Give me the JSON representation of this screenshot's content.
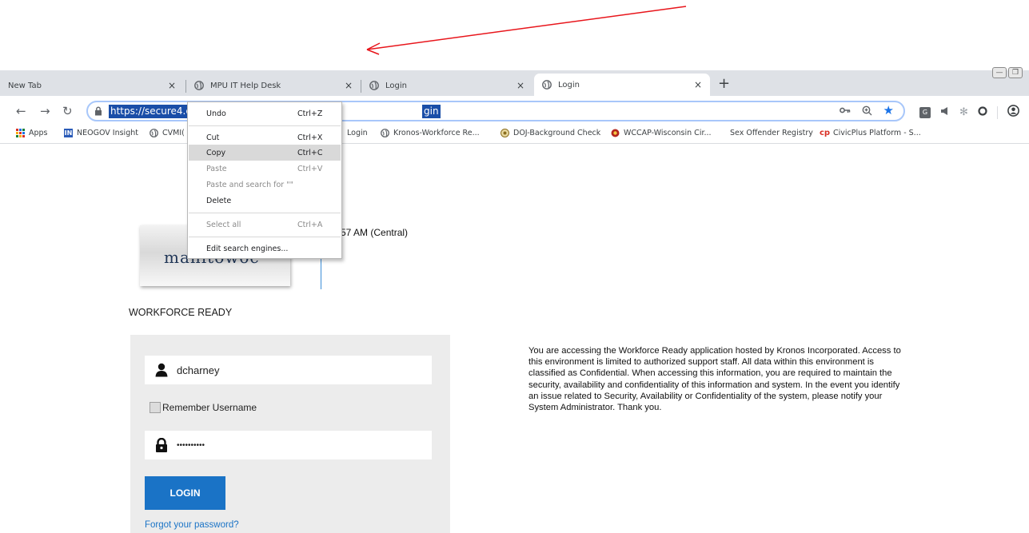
{
  "tabs": [
    {
      "label": "New Tab",
      "has_icon": false
    },
    {
      "label": "MPU IT Help Desk",
      "has_icon": true
    },
    {
      "label": "Login",
      "has_icon": true
    },
    {
      "label": "Login",
      "has_icon": true,
      "active": true
    }
  ],
  "tab_close_glyph": "×",
  "new_tab_glyph": "+",
  "omnibox": {
    "url_visible_start": "https://secure4.e",
    "url_visible_end": "gin"
  },
  "bookmarks": [
    {
      "label": "Apps",
      "icon": "apps-grid-icon"
    },
    {
      "label": "NEOGOV Insight",
      "icon": "neogov-icon"
    },
    {
      "label": "CVMI(",
      "icon": "globe-icon"
    },
    {
      "label": "Login",
      "icon": "none"
    },
    {
      "label": "Kronos-Workforce Re...",
      "icon": "globe-icon"
    },
    {
      "label": "DOJ-Background Check",
      "icon": "doj-seal-icon"
    },
    {
      "label": "WCCAP-Wisconsin Cir...",
      "icon": "wccap-icon"
    },
    {
      "label": "Sex Offender Registry",
      "icon": "none"
    },
    {
      "label": "CivicPlus Platform - S...",
      "icon": "civicplus-icon"
    }
  ],
  "context_menu": {
    "items": [
      {
        "label": "Undo",
        "shortcut": "Ctrl+Z"
      },
      {
        "label": "Cut",
        "shortcut": "Ctrl+X"
      },
      {
        "label": "Copy",
        "shortcut": "Ctrl+C",
        "highlighted": true
      },
      {
        "label": "Paste",
        "shortcut": "Ctrl+V",
        "disabled": true
      },
      {
        "label": "Paste and search for \"\"",
        "shortcut": "",
        "disabled": true
      },
      {
        "label": "Delete",
        "shortcut": ""
      },
      {
        "label": "Select all",
        "shortcut": "Ctrl+A",
        "disabled": true
      },
      {
        "label": "Edit search engines...",
        "shortcut": ""
      }
    ]
  },
  "page": {
    "logo_text": "manitowoc",
    "time_text": "57 AM (Central)",
    "title": "WORKFORCE READY",
    "username_value": "dcharney",
    "remember_label": "Remember Username",
    "password_mask": "••••••••••",
    "login_label": "LOGIN",
    "forgot_label": "Forgot your password?",
    "notice_text": "You are accessing the Workforce Ready application hosted by Kronos Incorporated. Access to this environment is limited to authorized support staff. All data within this environment is classified as Confidential. When accessing this information, you are required to maintain the security, availability and confidentiality of this information and system. In the event you identify an issue related to Security, Availability or Confidentiality of the system, please notify your System Administrator. Thank you."
  },
  "colors": {
    "annotation_arrow": "#e8151b",
    "url_selection": "#1a4ea8",
    "login_button": "#1a73c6",
    "panel_bg": "#ececec"
  }
}
